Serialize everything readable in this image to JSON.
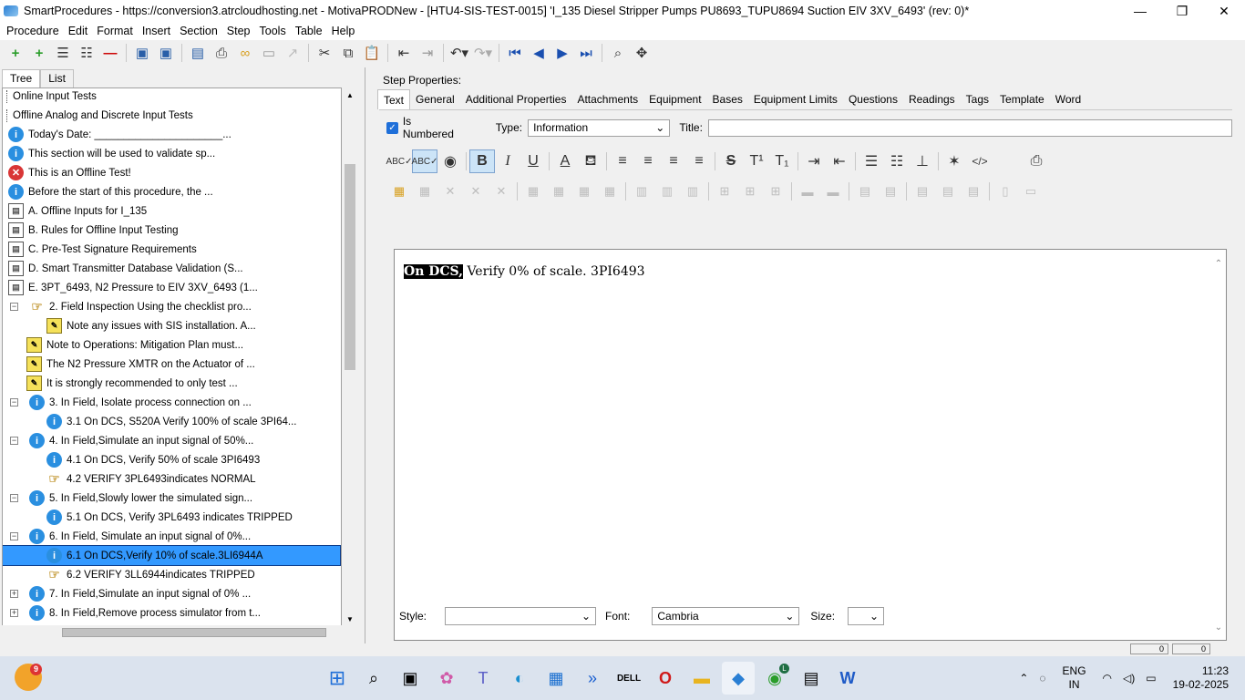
{
  "window": {
    "title": "SmartProcedures - https://conversion3.atrcloudhosting.net - MotivaPRODNew - [HTU4-SIS-TEST-0015] 'I_135 Diesel Stripper Pumps PU8693_TUPU8694 Suction EIV 3XV_6493' (rev: 0)*",
    "min": "—",
    "max": "❐",
    "close": "✕"
  },
  "menu": [
    "Procedure",
    "Edit",
    "Format",
    "Insert",
    "Section",
    "Step",
    "Tools",
    "Table",
    "Help"
  ],
  "left_tabs": [
    "Tree",
    "List"
  ],
  "tree": [
    {
      "text": "Online Input Tests",
      "icon": "none",
      "indent": 0,
      "expander": ""
    },
    {
      "text": "Offline Analog and Discrete Input Tests",
      "icon": "none",
      "indent": 0,
      "expander": ""
    },
    {
      "text": "Today's Date: ______________________...",
      "icon": "info",
      "indent": 1,
      "expander": ""
    },
    {
      "text": "This section will be used to validate sp...",
      "icon": "info",
      "indent": 1,
      "expander": ""
    },
    {
      "text": "This is an Offline Test!",
      "icon": "err",
      "indent": 1,
      "expander": ""
    },
    {
      "text": "Before the start of this procedure, the ...",
      "icon": "info",
      "indent": 1,
      "expander": ""
    },
    {
      "text": "A. Offline Inputs for I_135",
      "icon": "doc",
      "indent": 1,
      "expander": ""
    },
    {
      "text": "B. Rules for Offline Input Testing",
      "icon": "doc",
      "indent": 1,
      "expander": ""
    },
    {
      "text": "C. Pre-Test Signature Requirements",
      "icon": "doc",
      "indent": 1,
      "expander": ""
    },
    {
      "text": "D. Smart Transmitter Database Validation (S...",
      "icon": "doc",
      "indent": 1,
      "expander": ""
    },
    {
      "text": "E. 3PT_6493, N2 Pressure to EIV 3XV_6493 (1...",
      "icon": "doc",
      "indent": 1,
      "expander": ""
    },
    {
      "text": "2. Field Inspection Using the checklist pro...",
      "icon": "hand",
      "indent": 1,
      "expander": "−"
    },
    {
      "text": "Note any issues with SIS installation. A...",
      "icon": "note",
      "indent": 2,
      "expander": ""
    },
    {
      "text": "Note to Operations: Mitigation Plan must...",
      "icon": "note",
      "indent": 1,
      "expander": ""
    },
    {
      "text": "The N2 Pressure XMTR on the Actuator of ...",
      "icon": "note",
      "indent": 1,
      "expander": ""
    },
    {
      "text": "It is strongly recommended to only test ...",
      "icon": "note",
      "indent": 1,
      "expander": ""
    },
    {
      "text": "3. In Field, Isolate process connection on ...",
      "icon": "info",
      "indent": 1,
      "expander": "−"
    },
    {
      "text": "3.1 On DCS, S520A Verify 100% of scale 3PI64...",
      "icon": "info",
      "indent": 2,
      "expander": ""
    },
    {
      "text": "4. In Field,Simulate an input signal of 50%...",
      "icon": "info",
      "indent": 1,
      "expander": "−"
    },
    {
      "text": "4.1 On DCS, Verify 50% of scale 3PI6493",
      "icon": "info",
      "indent": 2,
      "expander": ""
    },
    {
      "text": "4.2 VERIFY 3PL6493indicates NORMAL",
      "icon": "hand",
      "indent": 2,
      "expander": ""
    },
    {
      "text": "5. In Field,Slowly lower the simulated sign...",
      "icon": "info",
      "indent": 1,
      "expander": "−"
    },
    {
      "text": "5.1 On DCS, Verify 3PL6493 indicates TRIPPED",
      "icon": "info",
      "indent": 2,
      "expander": ""
    },
    {
      "text": "6. In Field, Simulate an input signal of 0%...",
      "icon": "info",
      "indent": 1,
      "expander": "−"
    },
    {
      "text": "6.1 On DCS,Verify 10% of scale.3LI6944A",
      "icon": "info",
      "indent": 2,
      "expander": "",
      "selected": true
    },
    {
      "text": "6.2 VERIFY 3LL6944indicates TRIPPED",
      "icon": "hand",
      "indent": 2,
      "expander": ""
    },
    {
      "text": "7. In Field,Simulate an input signal of 0% ...",
      "icon": "info",
      "indent": 1,
      "expander": "+"
    },
    {
      "text": "8. In Field,Remove process simulator from t...",
      "icon": "info",
      "indent": 1,
      "expander": "+"
    }
  ],
  "step_properties_label": "Step Properties:",
  "right_tabs": [
    "Text",
    "General",
    "Additional Properties",
    "Attachments",
    "Equipment",
    "Bases",
    "Equipment Limits",
    "Questions",
    "Readings",
    "Tags",
    "Template",
    "Word"
  ],
  "is_numbered_label": "Is Numbered",
  "type_label": "Type:",
  "type_value": "Information",
  "title_label": "Title:",
  "editor": {
    "highlight": "On DCS,",
    "rest": " Verify 0% of scale. 3PI6493"
  },
  "bottom": {
    "style_label": "Style:",
    "style_value": "",
    "font_label": "Font:",
    "font_value": "Cambria",
    "size_label": "Size:",
    "size_value": ""
  },
  "status": [
    "0",
    "0"
  ],
  "taskbar": {
    "weather_badge": "9",
    "chrome_badge": "L",
    "tray_lang": "ENG",
    "tray_region": "IN",
    "time": "11:23",
    "date": "19-02-2025"
  }
}
